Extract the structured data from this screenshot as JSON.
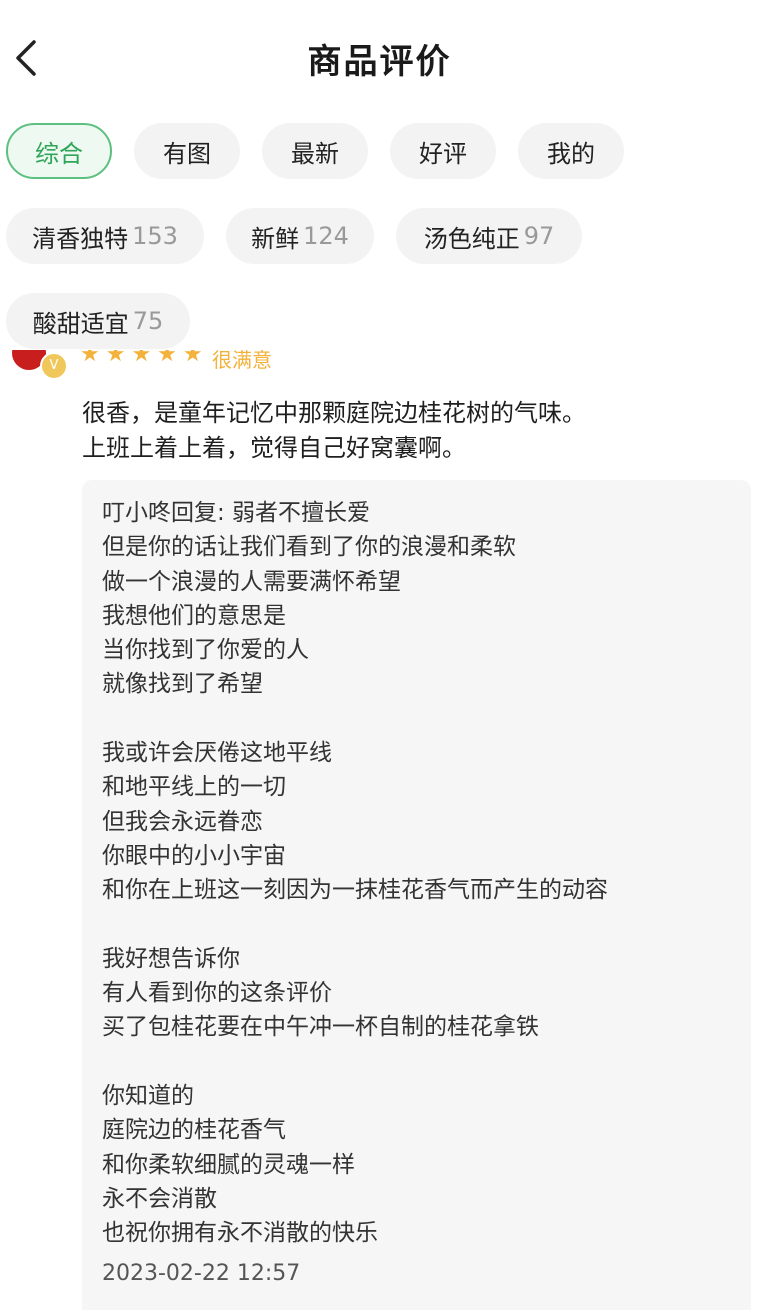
{
  "header": {
    "title": "商品评价"
  },
  "filters": [
    {
      "label": "综合",
      "active": true
    },
    {
      "label": "有图"
    },
    {
      "label": "最新"
    },
    {
      "label": "好评"
    },
    {
      "label": "我的"
    }
  ],
  "tags": [
    {
      "label": "清香独特",
      "count": "153"
    },
    {
      "label": "新鲜",
      "count": "124"
    },
    {
      "label": "汤色纯正",
      "count": "97"
    },
    {
      "label": "酸甜适宜",
      "count": "75"
    }
  ],
  "review": {
    "stars": "★★★★★",
    "rating_text": "很满意",
    "vip_badge": "V",
    "lines": [
      "很香，是童年记忆中那颗庭院边桂花树的气味。",
      "上班上着上着，觉得自己好窝囊啊。"
    ],
    "reply": {
      "lines": [
        "叮小咚回复: 弱者不擅长爱",
        "但是你的话让我们看到了你的浪漫和柔软",
        "做一个浪漫的人需要满怀希望",
        "我想他们的意思是",
        "当你找到了你爱的人",
        "就像找到了希望",
        "",
        "我或许会厌倦这地平线",
        "和地平线上的一切",
        "但我会永远眷恋",
        "你眼中的小小宇宙",
        "和你在上班这一刻因为一抹桂花香气而产生的动容",
        "",
        "我好想告诉你",
        "有人看到你的这条评价",
        "买了包桂花要在中午冲一杯自制的桂花拿铁",
        "",
        "你知道的",
        "庭院边的桂花香气",
        "和你柔软细腻的灵魂一样",
        "永不会消散",
        "也祝你拥有永不消散的快乐"
      ],
      "time": "2023-02-22 12:57"
    }
  },
  "colors": {
    "accent_green": "#2fa55a",
    "star": "#f3b23a"
  }
}
